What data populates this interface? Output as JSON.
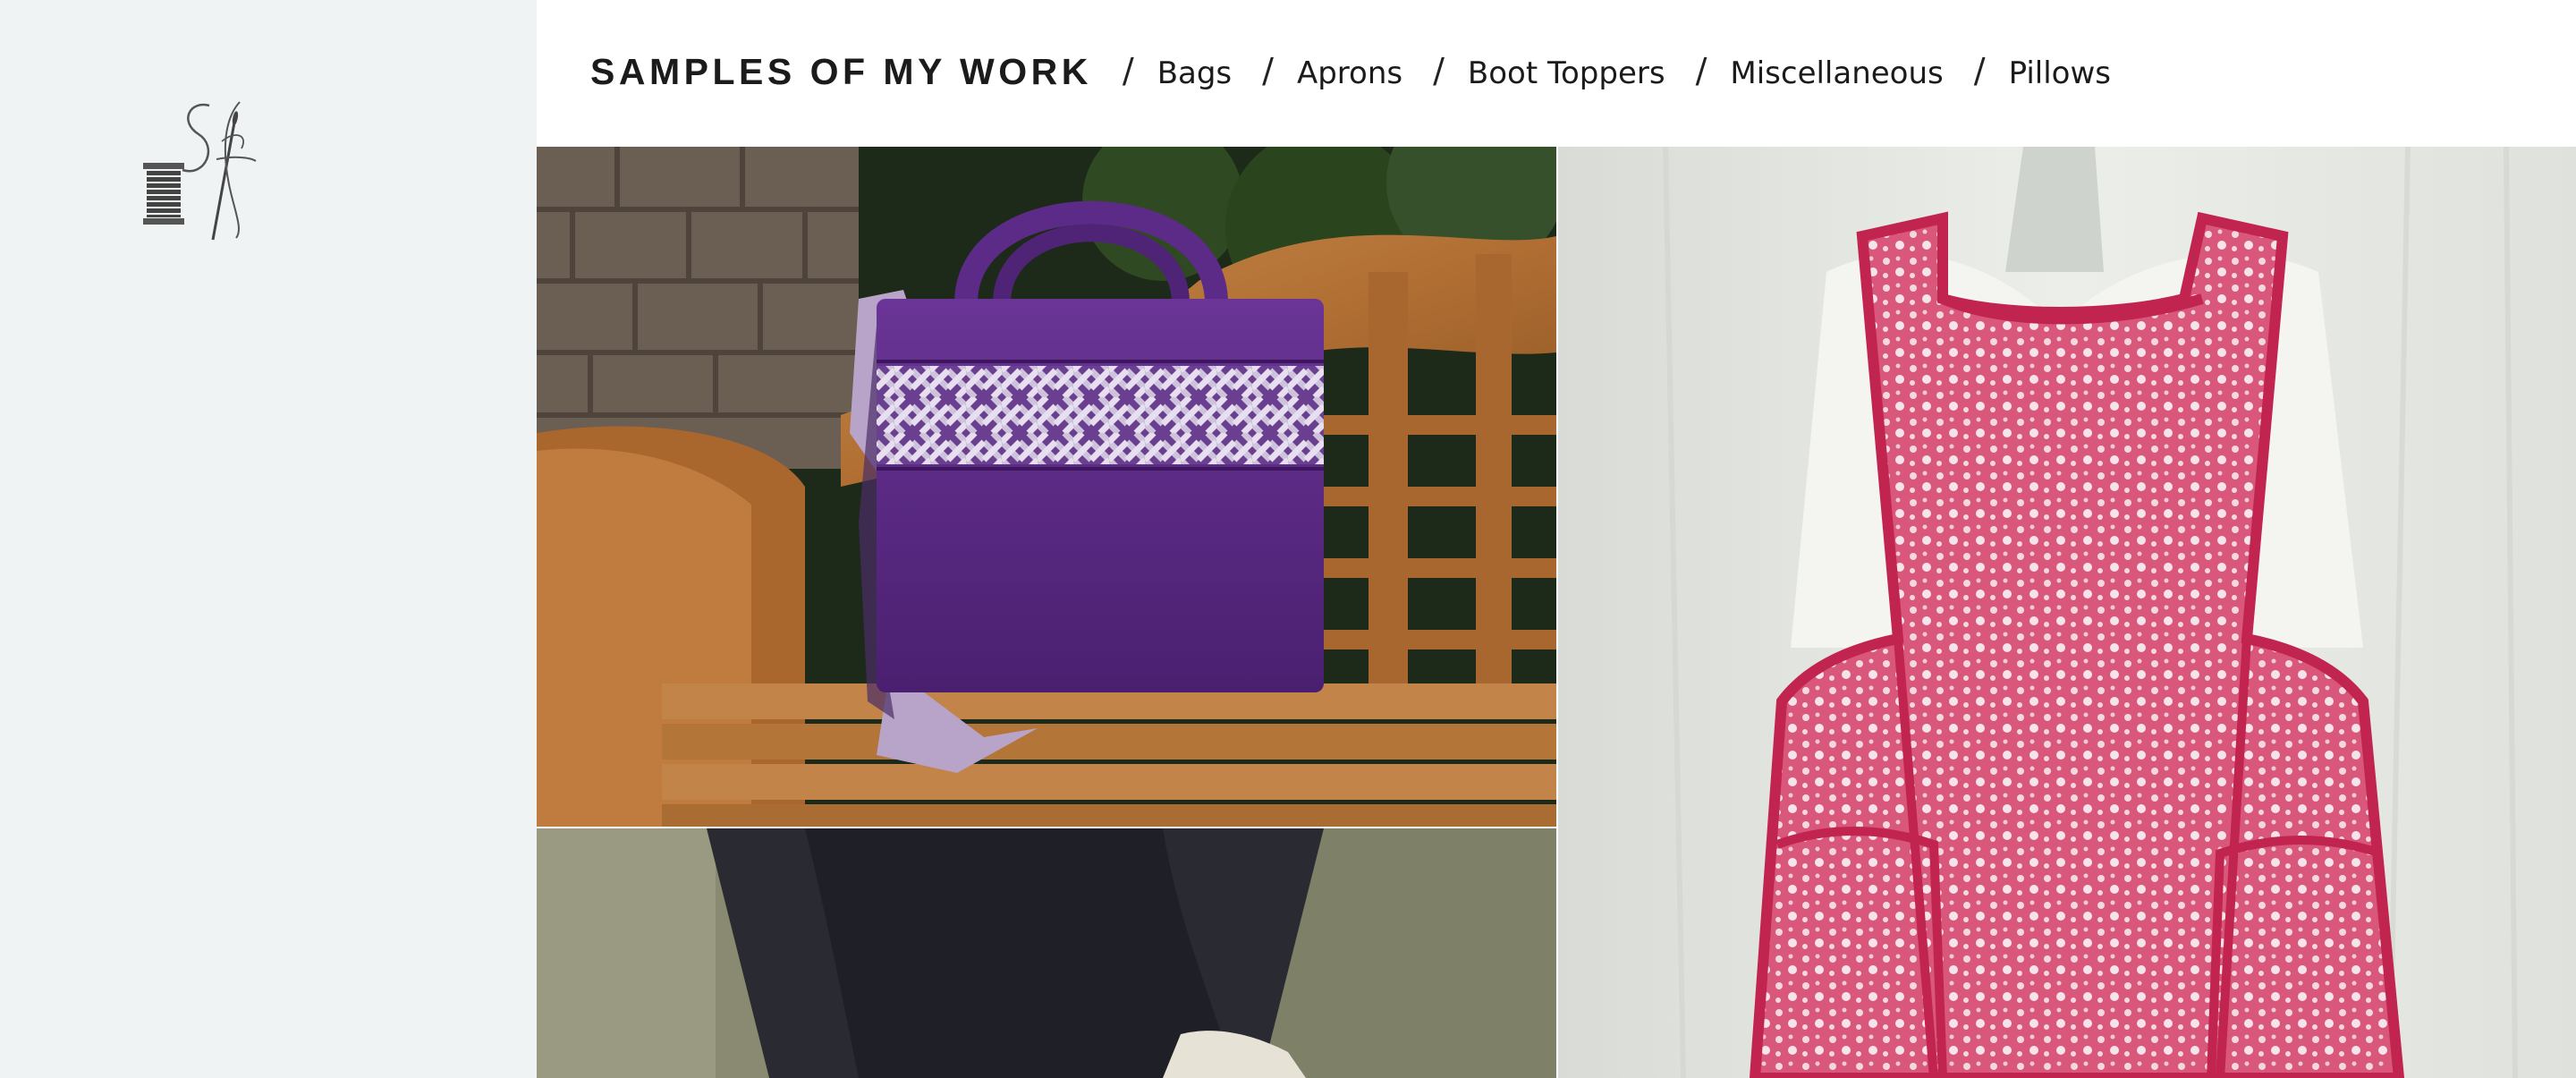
{
  "header": {
    "site_title": "SAMPLES OF MY WORK",
    "separator": "/",
    "nav": [
      {
        "label": "Bags"
      },
      {
        "label": "Aprons"
      },
      {
        "label": "Boot Toppers"
      },
      {
        "label": "Miscellaneous"
      },
      {
        "label": "Pillows"
      }
    ]
  },
  "logo": {
    "monogram": "Sf",
    "icon": "spool-and-needle-icon"
  },
  "gallery": {
    "items": [
      {
        "subject": "purple-tote-bag-photo"
      },
      {
        "subject": "pink-floral-apron-photo"
      },
      {
        "subject": "boot-topper-photo"
      }
    ]
  },
  "colors": {
    "sidebar_bg": "#eff3f4",
    "nav_text": "#1b1b1b",
    "bag_purple": "#5b2a86",
    "apron_pink": "#c8395f"
  }
}
